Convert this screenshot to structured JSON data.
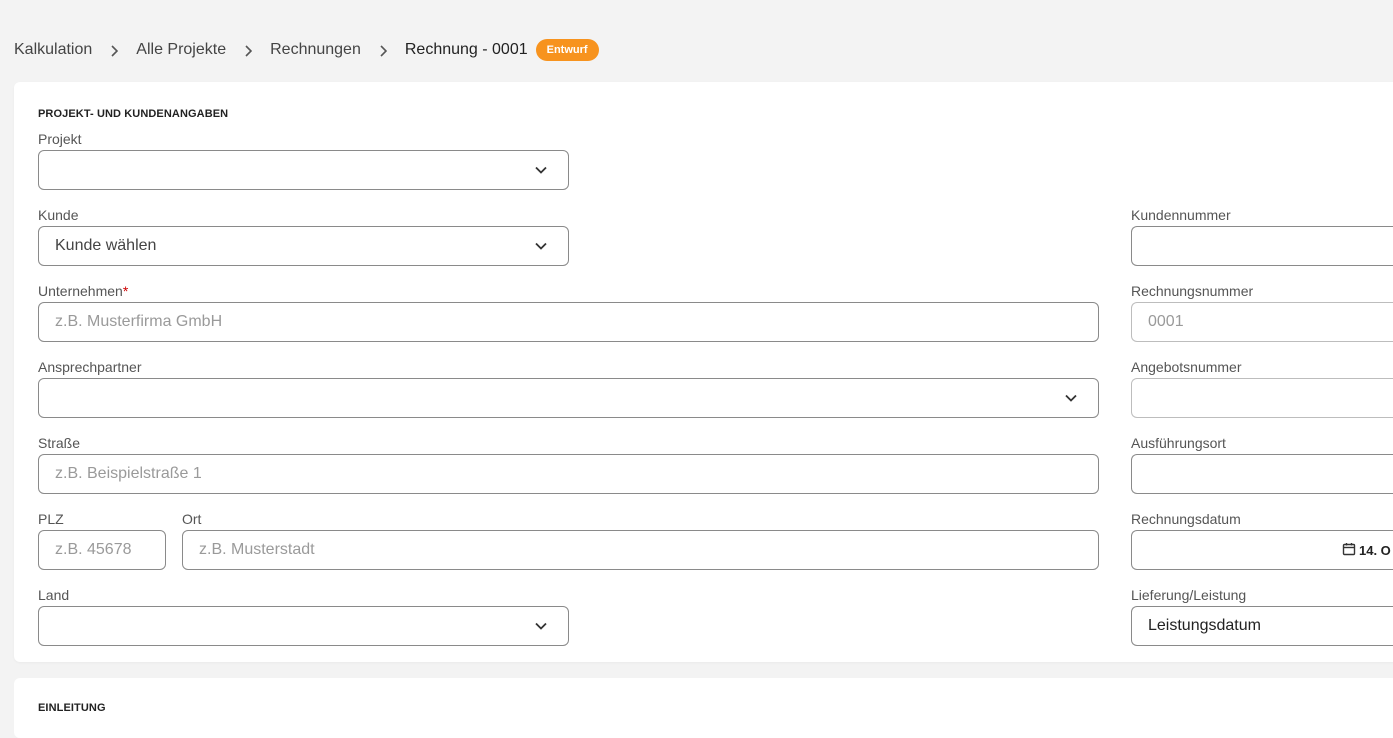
{
  "breadcrumb": {
    "items": [
      "Kalkulation",
      "Alle Projekte",
      "Rechnungen"
    ],
    "current": "Rechnung - 0001",
    "badge": "Entwurf"
  },
  "section1": {
    "title": "PROJEKT- UND KUNDENANGABEN",
    "projekt": {
      "label": "Projekt",
      "value": ""
    },
    "kunde": {
      "label": "Kunde",
      "value": "Kunde wählen"
    },
    "unternehmen": {
      "label": "Unternehmen",
      "required": "*",
      "placeholder": "z.B. Musterfirma GmbH"
    },
    "ansprechpartner": {
      "label": "Ansprechpartner",
      "value": ""
    },
    "strasse": {
      "label": "Straße",
      "placeholder": "z.B. Beispielstraße 1"
    },
    "plz": {
      "label": "PLZ",
      "placeholder": "z.B. 45678"
    },
    "ort": {
      "label": "Ort",
      "placeholder": "z.B. Musterstadt"
    },
    "land": {
      "label": "Land",
      "value": ""
    },
    "kundennummer": {
      "label": "Kundennummer",
      "value": ""
    },
    "rechnungsnummer": {
      "label": "Rechnungsnummer",
      "placeholder": "0001"
    },
    "angebotsnummer": {
      "label": "Angebotsnummer",
      "value": ""
    },
    "ausfuehrungsort": {
      "label": "Ausführungsort",
      "value": ""
    },
    "rechnungsdatum": {
      "label": "Rechnungsdatum",
      "value": "14. O"
    },
    "lieferung": {
      "label": "Lieferung/Leistung",
      "value": "Leistungsdatum"
    }
  },
  "section2": {
    "title": "EINLEITUNG"
  },
  "icons": {
    "chevron": "chevron-down-icon",
    "breadcrumb_separator": "chevron-right-icon",
    "calendar": "calendar-icon"
  },
  "colors": {
    "badge": "#f7931e",
    "background": "#f3f3f3",
    "required": "#c00000"
  }
}
